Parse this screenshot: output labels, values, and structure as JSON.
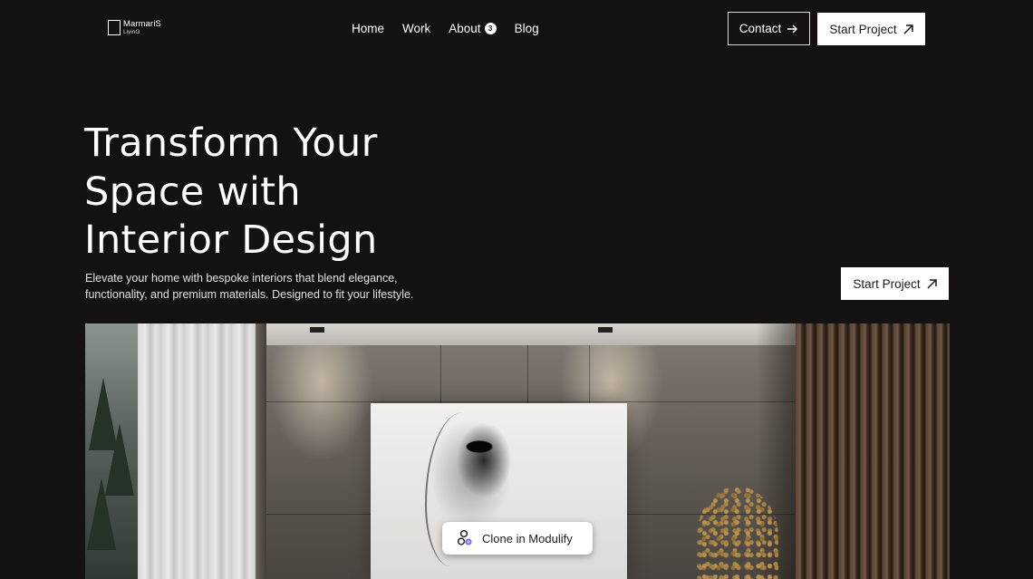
{
  "logo": {
    "line1": "MarmariS",
    "line2": "LivinG"
  },
  "nav": {
    "items": [
      {
        "label": "Home"
      },
      {
        "label": "Work"
      },
      {
        "label": "About",
        "badge": "3"
      },
      {
        "label": "Blog"
      }
    ]
  },
  "header_actions": {
    "contact_label": "Contact",
    "start_project_label": "Start Project"
  },
  "hero": {
    "title_lines": [
      "Transform Your",
      "Space with",
      "Interior Design"
    ],
    "description_lines": [
      "Elevate your home with bespoke interiors that blend elegance,",
      "functionality, and premium materials. Designed to fit your lifestyle."
    ],
    "cta_label": "Start Project"
  },
  "clone_badge": {
    "label": "Clone in Modulify"
  },
  "colors": {
    "background": "#131111",
    "button_bg": "#ffffff",
    "text": "#ffffff"
  }
}
